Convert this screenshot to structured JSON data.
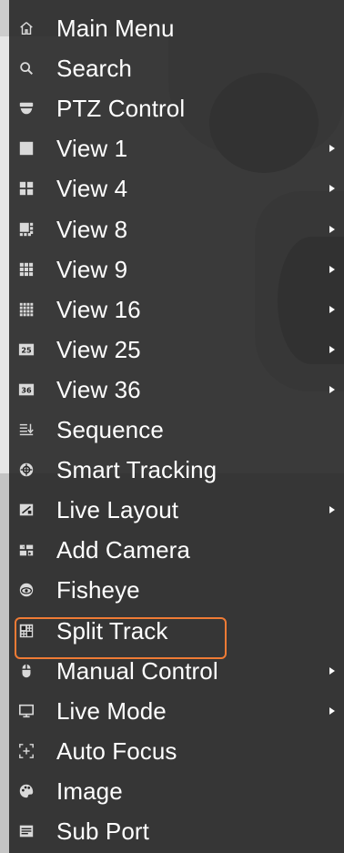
{
  "menu": {
    "items": [
      {
        "label": "Main Menu",
        "icon": "home-icon",
        "has_submenu": false
      },
      {
        "label": "Search",
        "icon": "search-icon",
        "has_submenu": false
      },
      {
        "label": "PTZ Control",
        "icon": "ptz-camera-icon",
        "has_submenu": false
      },
      {
        "label": "View 1",
        "icon": "view-1-icon",
        "has_submenu": true
      },
      {
        "label": "View 4",
        "icon": "view-4-icon",
        "has_submenu": true
      },
      {
        "label": "View 8",
        "icon": "view-8-icon",
        "has_submenu": true
      },
      {
        "label": "View 9",
        "icon": "view-9-icon",
        "has_submenu": true
      },
      {
        "label": "View 16",
        "icon": "view-16-icon",
        "has_submenu": true
      },
      {
        "label": "View 25",
        "icon": "view-25-icon",
        "has_submenu": true
      },
      {
        "label": "View 36",
        "icon": "view-36-icon",
        "has_submenu": true
      },
      {
        "label": "Sequence",
        "icon": "sequence-icon",
        "has_submenu": false
      },
      {
        "label": "Smart Tracking",
        "icon": "smart-tracking-icon",
        "has_submenu": false
      },
      {
        "label": "Live Layout",
        "icon": "live-layout-icon",
        "has_submenu": true
      },
      {
        "label": "Add Camera",
        "icon": "add-camera-icon",
        "has_submenu": false
      },
      {
        "label": "Fisheye",
        "icon": "fisheye-icon",
        "has_submenu": false
      },
      {
        "label": "Split Track",
        "icon": "split-track-icon",
        "has_submenu": false,
        "selected": true
      },
      {
        "label": "Manual Control",
        "icon": "manual-control-icon",
        "has_submenu": true
      },
      {
        "label": "Live Mode",
        "icon": "live-mode-icon",
        "has_submenu": true
      },
      {
        "label": "Auto Focus",
        "icon": "auto-focus-icon",
        "has_submenu": false
      },
      {
        "label": "Image",
        "icon": "image-icon",
        "has_submenu": false
      },
      {
        "label": "Sub Port",
        "icon": "sub-port-icon",
        "has_submenu": false
      }
    ],
    "icon_25_text": "25",
    "icon_36_text": "36"
  },
  "colors": {
    "menu_bg": "#222222",
    "text": "#ffffff",
    "icon": "#d9d9d9",
    "highlight_border": "#ef7b35"
  }
}
